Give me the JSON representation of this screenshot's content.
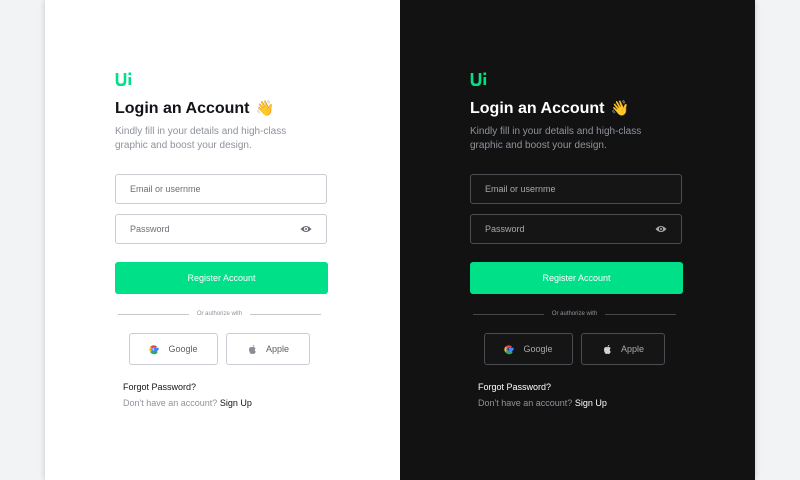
{
  "colors": {
    "accent": "#00e088",
    "light_bg": "#ffffff",
    "dark_bg": "#121212"
  },
  "panels": [
    {
      "theme": "light",
      "logo": "Ui",
      "title": "Login an Account",
      "wave_emoji": "👋",
      "subtitle": "Kindly fill in your details and high-class graphic and boost your design.",
      "email_placeholder": "Email or usernme",
      "password_placeholder": "Password",
      "password_icon": "eye-icon",
      "primary_button": "Register Account",
      "divider_text": "Or authorize with",
      "google_label": "Google",
      "apple_label": "Apple",
      "forgot_password": "Forgot Password?",
      "no_account_text": "Don't have an account?",
      "signup_link": "Sign Up"
    },
    {
      "theme": "dark",
      "logo": "Ui",
      "title": "Login an Account",
      "wave_emoji": "👋",
      "subtitle": "Kindly fill in your details and high-class graphic and boost your design.",
      "email_placeholder": "Email or usernme",
      "password_placeholder": "Password",
      "password_icon": "eye-icon",
      "primary_button": "Register Account",
      "divider_text": "Or authorize with",
      "google_label": "Google",
      "apple_label": "Apple",
      "forgot_password": "Forgot Password?",
      "no_account_text": "Don't have an account?",
      "signup_link": "Sign Up"
    }
  ]
}
